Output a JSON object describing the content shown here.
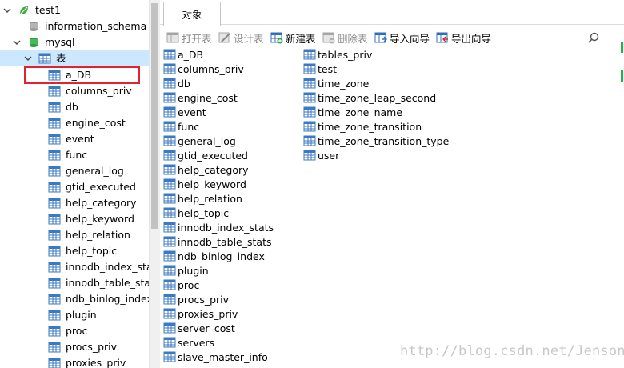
{
  "nav": {
    "connection": "test1",
    "databases": [
      "information_schema",
      "mysql"
    ],
    "tables_folder": "表",
    "tables": [
      "a_DB",
      "columns_priv",
      "db",
      "engine_cost",
      "event",
      "func",
      "general_log",
      "gtid_executed",
      "help_category",
      "help_keyword",
      "help_relation",
      "help_topic",
      "innodb_index_stat",
      "innodb_table_stat",
      "ndb_binlog_index",
      "plugin",
      "proc",
      "procs_priv",
      "proxies_priv"
    ]
  },
  "tab": {
    "label": "对象"
  },
  "toolbar": {
    "open_table": "打开表",
    "design_table": "设计表",
    "new_table": "新建表",
    "delete_table": "删除表",
    "import_wizard": "导入向导",
    "export_wizard": "导出向导"
  },
  "objects": {
    "col1": [
      "a_DB",
      "columns_priv",
      "db",
      "engine_cost",
      "event",
      "func",
      "general_log",
      "gtid_executed",
      "help_category",
      "help_keyword",
      "help_relation",
      "help_topic",
      "innodb_index_stats",
      "innodb_table_stats",
      "ndb_binlog_index",
      "plugin",
      "proc",
      "procs_priv",
      "proxies_priv",
      "server_cost",
      "servers",
      "slave_master_info"
    ],
    "col2": [
      "tables_priv",
      "test",
      "time_zone",
      "time_zone_leap_second",
      "time_zone_name",
      "time_zone_transition",
      "time_zone_transition_type",
      "user"
    ]
  },
  "watermark": "http://blog.csdn.net/Jenson_"
}
